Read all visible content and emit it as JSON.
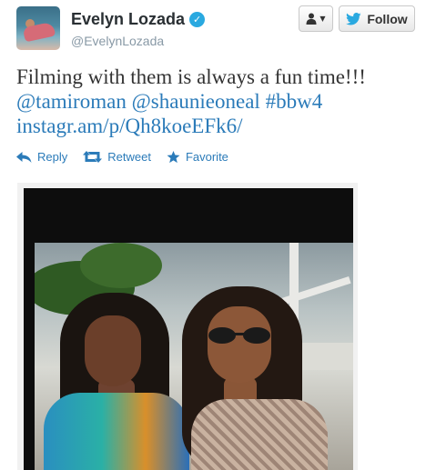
{
  "user": {
    "display_name": "Evelyn Lozada",
    "handle": "@EvelynLozada",
    "verified_glyph": "✓",
    "avatar_icon": "profile-photo"
  },
  "header": {
    "user_menu_caret": "▼",
    "follow_label": "Follow"
  },
  "tweet": {
    "text_line1": "Filming with them is always a fun time!!!",
    "mention1": "@tamiroman",
    "mention2": "@shaunieoneal",
    "hashtag": "#bbw4",
    "link": "instagr.am/p/Qh8koeEFk6/"
  },
  "actions": {
    "reply_label": "Reply",
    "retweet_label": "Retweet",
    "favorite_label": "Favorite"
  },
  "colors": {
    "link": "#2b7bb9",
    "verified": "#2aa9e0",
    "twitter_bird": "#2aa9e0",
    "action": "#2b7bb9"
  }
}
